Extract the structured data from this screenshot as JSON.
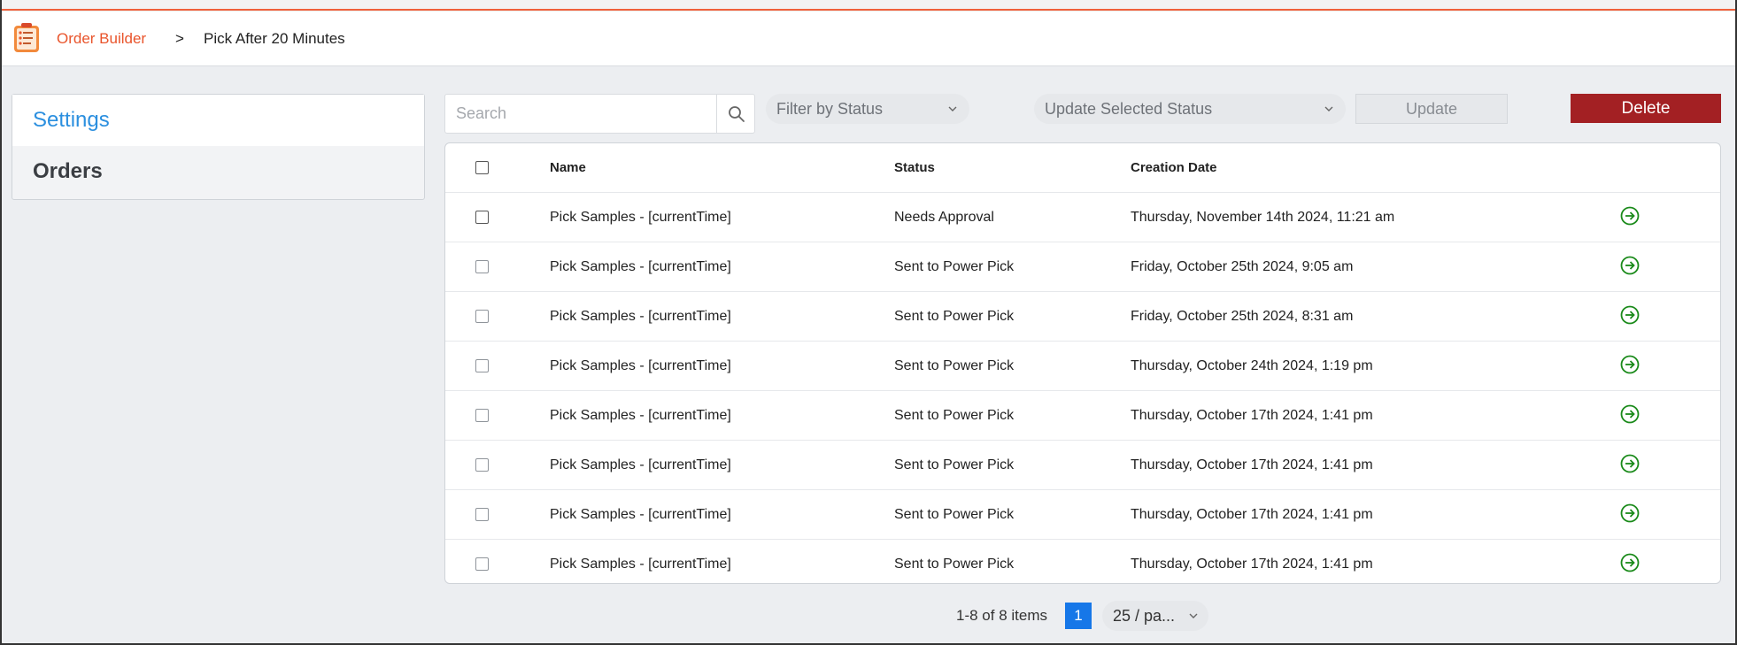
{
  "header": {
    "breadcrumb_root": "Order Builder",
    "breadcrumb_separator": ">",
    "breadcrumb_current": "Pick After 20 Minutes"
  },
  "sidebar": {
    "items": [
      {
        "label": "Settings"
      },
      {
        "label": "Orders"
      }
    ]
  },
  "toolbar": {
    "search_placeholder": "Search",
    "filter_placeholder": "Filter by Status",
    "update_status_placeholder": "Update Selected Status",
    "update_label": "Update",
    "delete_label": "Delete"
  },
  "table": {
    "columns": {
      "name": "Name",
      "status": "Status",
      "date": "Creation Date"
    },
    "rows": [
      {
        "name": "Pick Samples - [currentTime]",
        "status": "Needs Approval",
        "date": "Thursday, November 14th 2024, 11:21 am"
      },
      {
        "name": "Pick Samples - [currentTime]",
        "status": "Sent to Power Pick",
        "date": "Friday, October 25th 2024, 9:05 am"
      },
      {
        "name": "Pick Samples - [currentTime]",
        "status": "Sent to Power Pick",
        "date": "Friday, October 25th 2024, 8:31 am"
      },
      {
        "name": "Pick Samples - [currentTime]",
        "status": "Sent to Power Pick",
        "date": "Thursday, October 24th 2024, 1:19 pm"
      },
      {
        "name": "Pick Samples - [currentTime]",
        "status": "Sent to Power Pick",
        "date": "Thursday, October 17th 2024, 1:41 pm"
      },
      {
        "name": "Pick Samples - [currentTime]",
        "status": "Sent to Power Pick",
        "date": "Thursday, October 17th 2024, 1:41 pm"
      },
      {
        "name": "Pick Samples - [currentTime]",
        "status": "Sent to Power Pick",
        "date": "Thursday, October 17th 2024, 1:41 pm"
      },
      {
        "name": "Pick Samples - [currentTime]",
        "status": "Sent to Power Pick",
        "date": "Thursday, October 17th 2024, 1:41 pm"
      }
    ]
  },
  "pagination": {
    "info": "1-8 of 8 items",
    "current_page": "1",
    "page_size": "25 / pa..."
  },
  "icons": {
    "logo": "order-builder-logo-icon",
    "search": "search-icon",
    "chevron": "chevron-down-icon",
    "row_action": "arrow-right-circle-icon"
  },
  "colors": {
    "brand": "#e9542b",
    "link": "#2b8fdf",
    "delete": "#a32023",
    "action": "#1a8a1a",
    "page_active": "#1677e8"
  }
}
